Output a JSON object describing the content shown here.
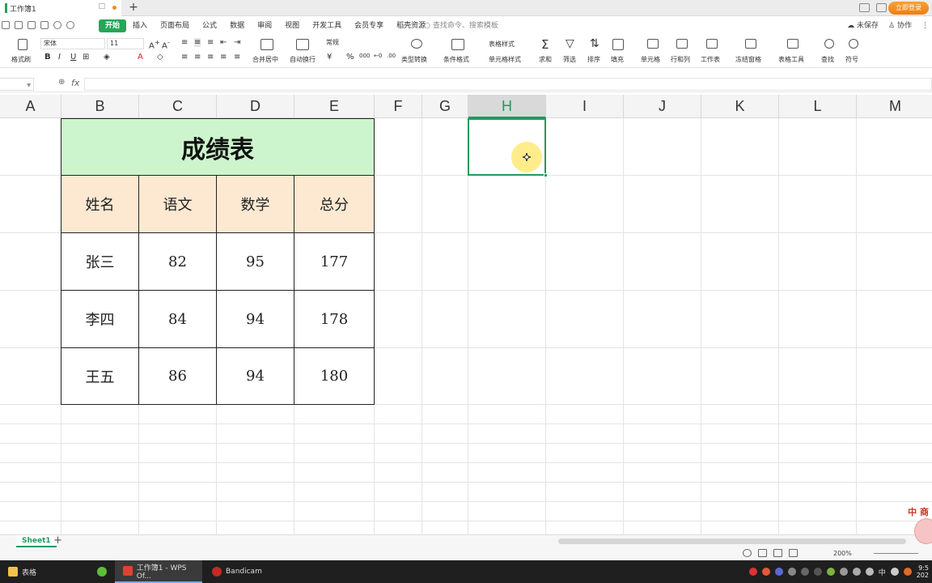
{
  "window": {
    "doc_tab_title": "工作簿1",
    "login_button": "立即登录"
  },
  "menu": {
    "tabs": [
      "开始",
      "插入",
      "页面布局",
      "公式",
      "数据",
      "审阅",
      "视图",
      "开发工具",
      "会员专享",
      "稻壳资源"
    ],
    "active_tab": "开始",
    "search_placeholder": "查找命令、搜索模板",
    "unsaved": "未保存",
    "collab": "协作"
  },
  "ribbon": {
    "format_painter": "格式刷",
    "font_name": "宋体",
    "font_size": "11",
    "merge_center": "合并居中",
    "wrap_text": "自动换行",
    "number_format": "常规",
    "currency": "¥",
    "percent": "%",
    "type_convert": "类型转换",
    "table_style": "表格样式",
    "cond_format": "条件格式",
    "cell_style": "单元格样式",
    "sum": "求和",
    "filter": "筛选",
    "sort": "排序",
    "fill": "填充",
    "cell": "单元格",
    "rowcol": "行和列",
    "worksheet": "工作表",
    "freeze": "冻结窗格",
    "table_tools": "表格工具",
    "find": "查找",
    "symbol": "符号"
  },
  "formula_bar": {
    "fx": "fx"
  },
  "grid": {
    "columns": [
      "A",
      "B",
      "C",
      "D",
      "E",
      "F",
      "G",
      "H",
      "I",
      "J",
      "K",
      "L",
      "M"
    ],
    "selected_column": "H"
  },
  "table": {
    "title": "成绩表",
    "headers": [
      "姓名",
      "语文",
      "数学",
      "总分"
    ],
    "rows": [
      [
        "张三",
        "82",
        "95",
        "177"
      ],
      [
        "李四",
        "84",
        "94",
        "178"
      ],
      [
        "王五",
        "86",
        "94",
        "180"
      ]
    ]
  },
  "sheets": {
    "active": "Sheet1"
  },
  "status": {
    "zoom": "200%"
  },
  "taskbar": {
    "items": [
      "表格",
      "工作簿1 - WPS Of...",
      "Bandicam"
    ],
    "ime": "中",
    "clock_time": "9:5",
    "clock_date": "202"
  },
  "watermark_text": "中 商",
  "colors": {
    "accent": "#1f9a5f",
    "title_fill": "#cdf5cd",
    "header_fill": "#fde9d2",
    "login": "#f08a24"
  }
}
